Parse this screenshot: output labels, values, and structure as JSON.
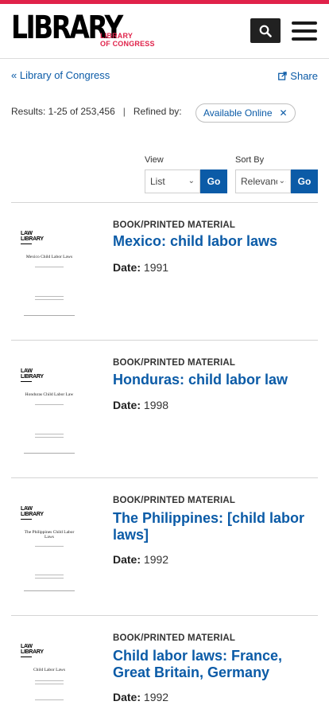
{
  "header": {
    "logo_main": "LIBRARY",
    "logo_sub_line1": "LIBRARY",
    "logo_sub_line2": "OF CONGRESS",
    "search_icon": "search-icon",
    "menu_icon": "hamburger-menu-icon"
  },
  "breadcrumb": {
    "text": "« Library of Congress"
  },
  "share": {
    "label": "Share",
    "icon": "share-icon"
  },
  "results": {
    "text": "Results: 1-25 of 253,456",
    "separator": "|",
    "refined_label": "Refined by:",
    "filter_pill": "Available Online",
    "filter_remove_icon": "close-icon"
  },
  "view": {
    "label": "View",
    "selected": "List",
    "go": "Go"
  },
  "sort": {
    "label": "Sort By",
    "selected": "Relevance",
    "go": "Go"
  },
  "items": [
    {
      "format": "BOOK/PRINTED MATERIAL",
      "title": "Mexico: child labor laws",
      "date_label": "Date:",
      "date": "1991",
      "thumb_title": "Mexico Child Labor Laws"
    },
    {
      "format": "BOOK/PRINTED MATERIAL",
      "title": "Honduras: child labor law",
      "date_label": "Date:",
      "date": "1998",
      "thumb_title": "Honduras Child Labor Law"
    },
    {
      "format": "BOOK/PRINTED MATERIAL",
      "title": "The Philippines: [child labor laws]",
      "date_label": "Date:",
      "date": "1992",
      "thumb_title": "The Philippines Child Labor Laws"
    },
    {
      "format": "BOOK/PRINTED MATERIAL",
      "title": "Child labor laws: France, Great Britain, Germany",
      "date_label": "Date:",
      "date": "1992",
      "thumb_title": "Child Labor Laws"
    }
  ],
  "colors": {
    "accent_red": "#e0224a",
    "link_blue": "#0b5ba7"
  }
}
